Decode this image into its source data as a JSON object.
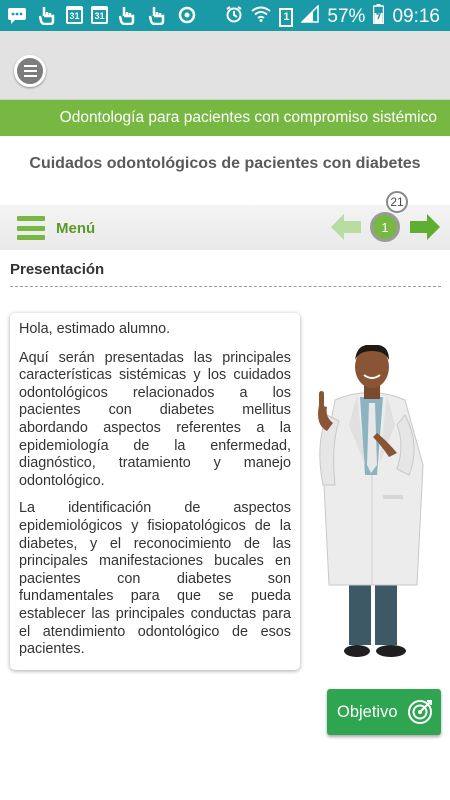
{
  "status_bar": {
    "battery": "57%",
    "time": "09:16",
    "calendar_day": "31",
    "sim_slot": "1",
    "icons": [
      "chat-icon",
      "hand-icon",
      "calendar-icon",
      "calendar-icon",
      "hand-icon",
      "hand-icon",
      "sync-icon",
      "alarm-icon",
      "wifi-icon",
      "sim-icon",
      "signal-icon",
      "battery-icon"
    ]
  },
  "header": {
    "course_name": "Odontología para pacientes con compromiso sistémico",
    "course_title": "Cuidados odontológicos de pacientes con diabetes"
  },
  "nav": {
    "menu_label": "Menú",
    "current_page": "1",
    "total_pages": "21"
  },
  "section": {
    "title": "Presentación"
  },
  "content": {
    "greeting": "Hola, estimado alumno.",
    "paragraph1": "Aquí serán presentadas las principales características sistémicas y los cuidados odontológicos relacionados a los pacientes con diabetes mellitus abordando aspectos referentes a la epidemiología de la enfermedad, diagnóstico, tratamiento y manejo odontológico.",
    "paragraph2": "La identificación de aspectos epidemiológicos y fisiopatológicos de la diabetes, y el reconocimiento de las principales manifestaciones bucales en pacientes con diabetes son fundamentales para que se pueda establecer las principales conductas para el atendimiento odontológico de esos pacientes."
  },
  "actions": {
    "objective_label": "Objetivo"
  },
  "colors": {
    "status_bar": "#1a9aa6",
    "accent_green": "#77b843",
    "button_green": "#2fa552",
    "header_gray": "#e2e2e2"
  }
}
